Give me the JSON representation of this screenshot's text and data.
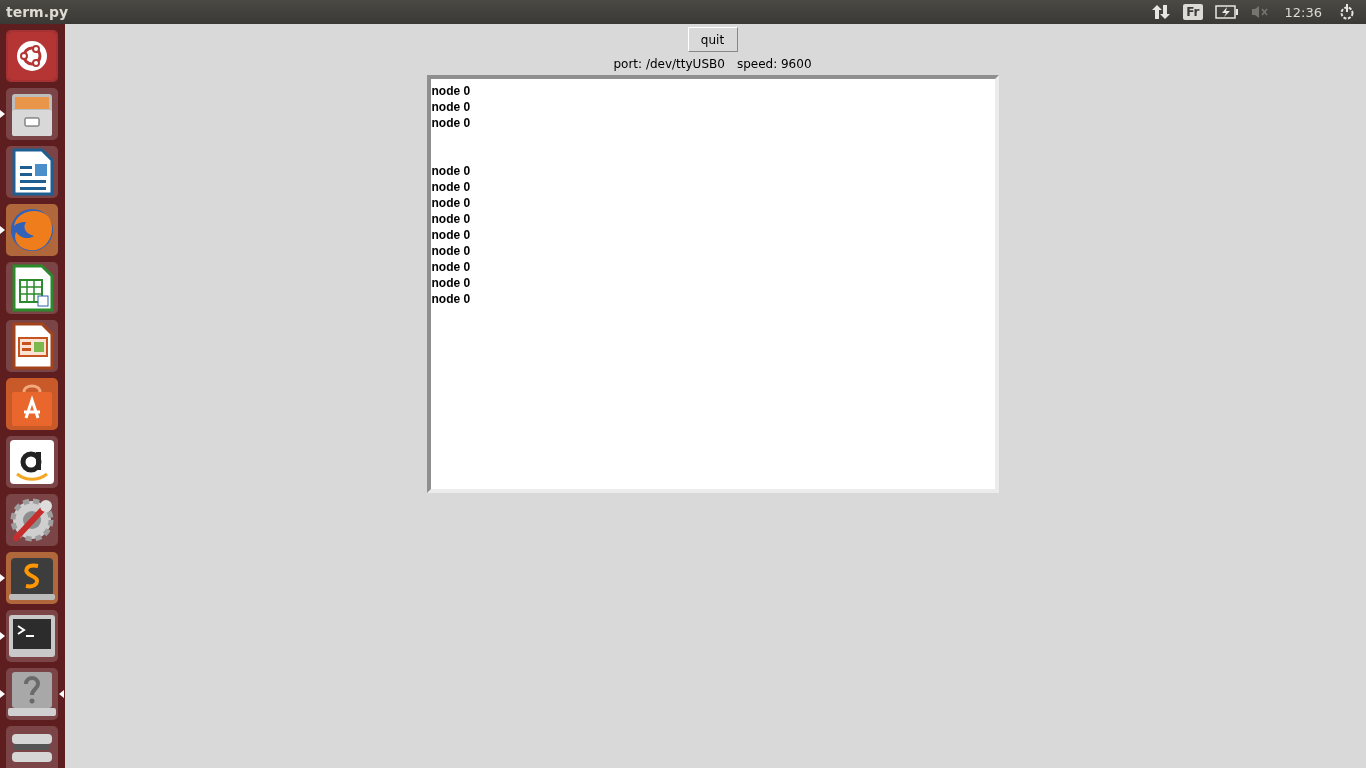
{
  "top_bar": {
    "title": "term.py",
    "keyboard_layout": "Fr",
    "clock": "12:36"
  },
  "launcher": [
    {
      "kind": "dash",
      "running": false
    },
    {
      "kind": "files",
      "running": true
    },
    {
      "kind": "writer",
      "running": false
    },
    {
      "kind": "firefox",
      "running": true
    },
    {
      "kind": "calc",
      "running": false
    },
    {
      "kind": "impress",
      "running": false
    },
    {
      "kind": "store",
      "running": false
    },
    {
      "kind": "amazon",
      "running": false
    },
    {
      "kind": "settings",
      "running": false
    },
    {
      "kind": "sublime",
      "running": true
    },
    {
      "kind": "terminal",
      "running": true
    },
    {
      "kind": "help",
      "running": true,
      "focused": true
    },
    {
      "kind": "trash",
      "running": false
    }
  ],
  "window": {
    "quit_button": "quit",
    "port_label": "port: /dev/ttyUSB0",
    "speed_label": "speed: 9600",
    "output_lines": [
      {
        "kind": "text",
        "text": "node 0"
      },
      {
        "kind": "text",
        "text": "node 0"
      },
      {
        "kind": "text",
        "text": "node 0"
      },
      {
        "kind": "blank"
      },
      {
        "kind": "blank"
      },
      {
        "kind": "text",
        "text": "node 0"
      },
      {
        "kind": "text",
        "text": "node 0"
      },
      {
        "kind": "text",
        "text": "node 0"
      },
      {
        "kind": "text",
        "text": "node 0"
      },
      {
        "kind": "text",
        "text": "node 0"
      },
      {
        "kind": "text",
        "text": "node 0"
      },
      {
        "kind": "text",
        "text": "node 0"
      },
      {
        "kind": "text",
        "text": "node 0"
      },
      {
        "kind": "text",
        "text": "node 0"
      }
    ]
  }
}
